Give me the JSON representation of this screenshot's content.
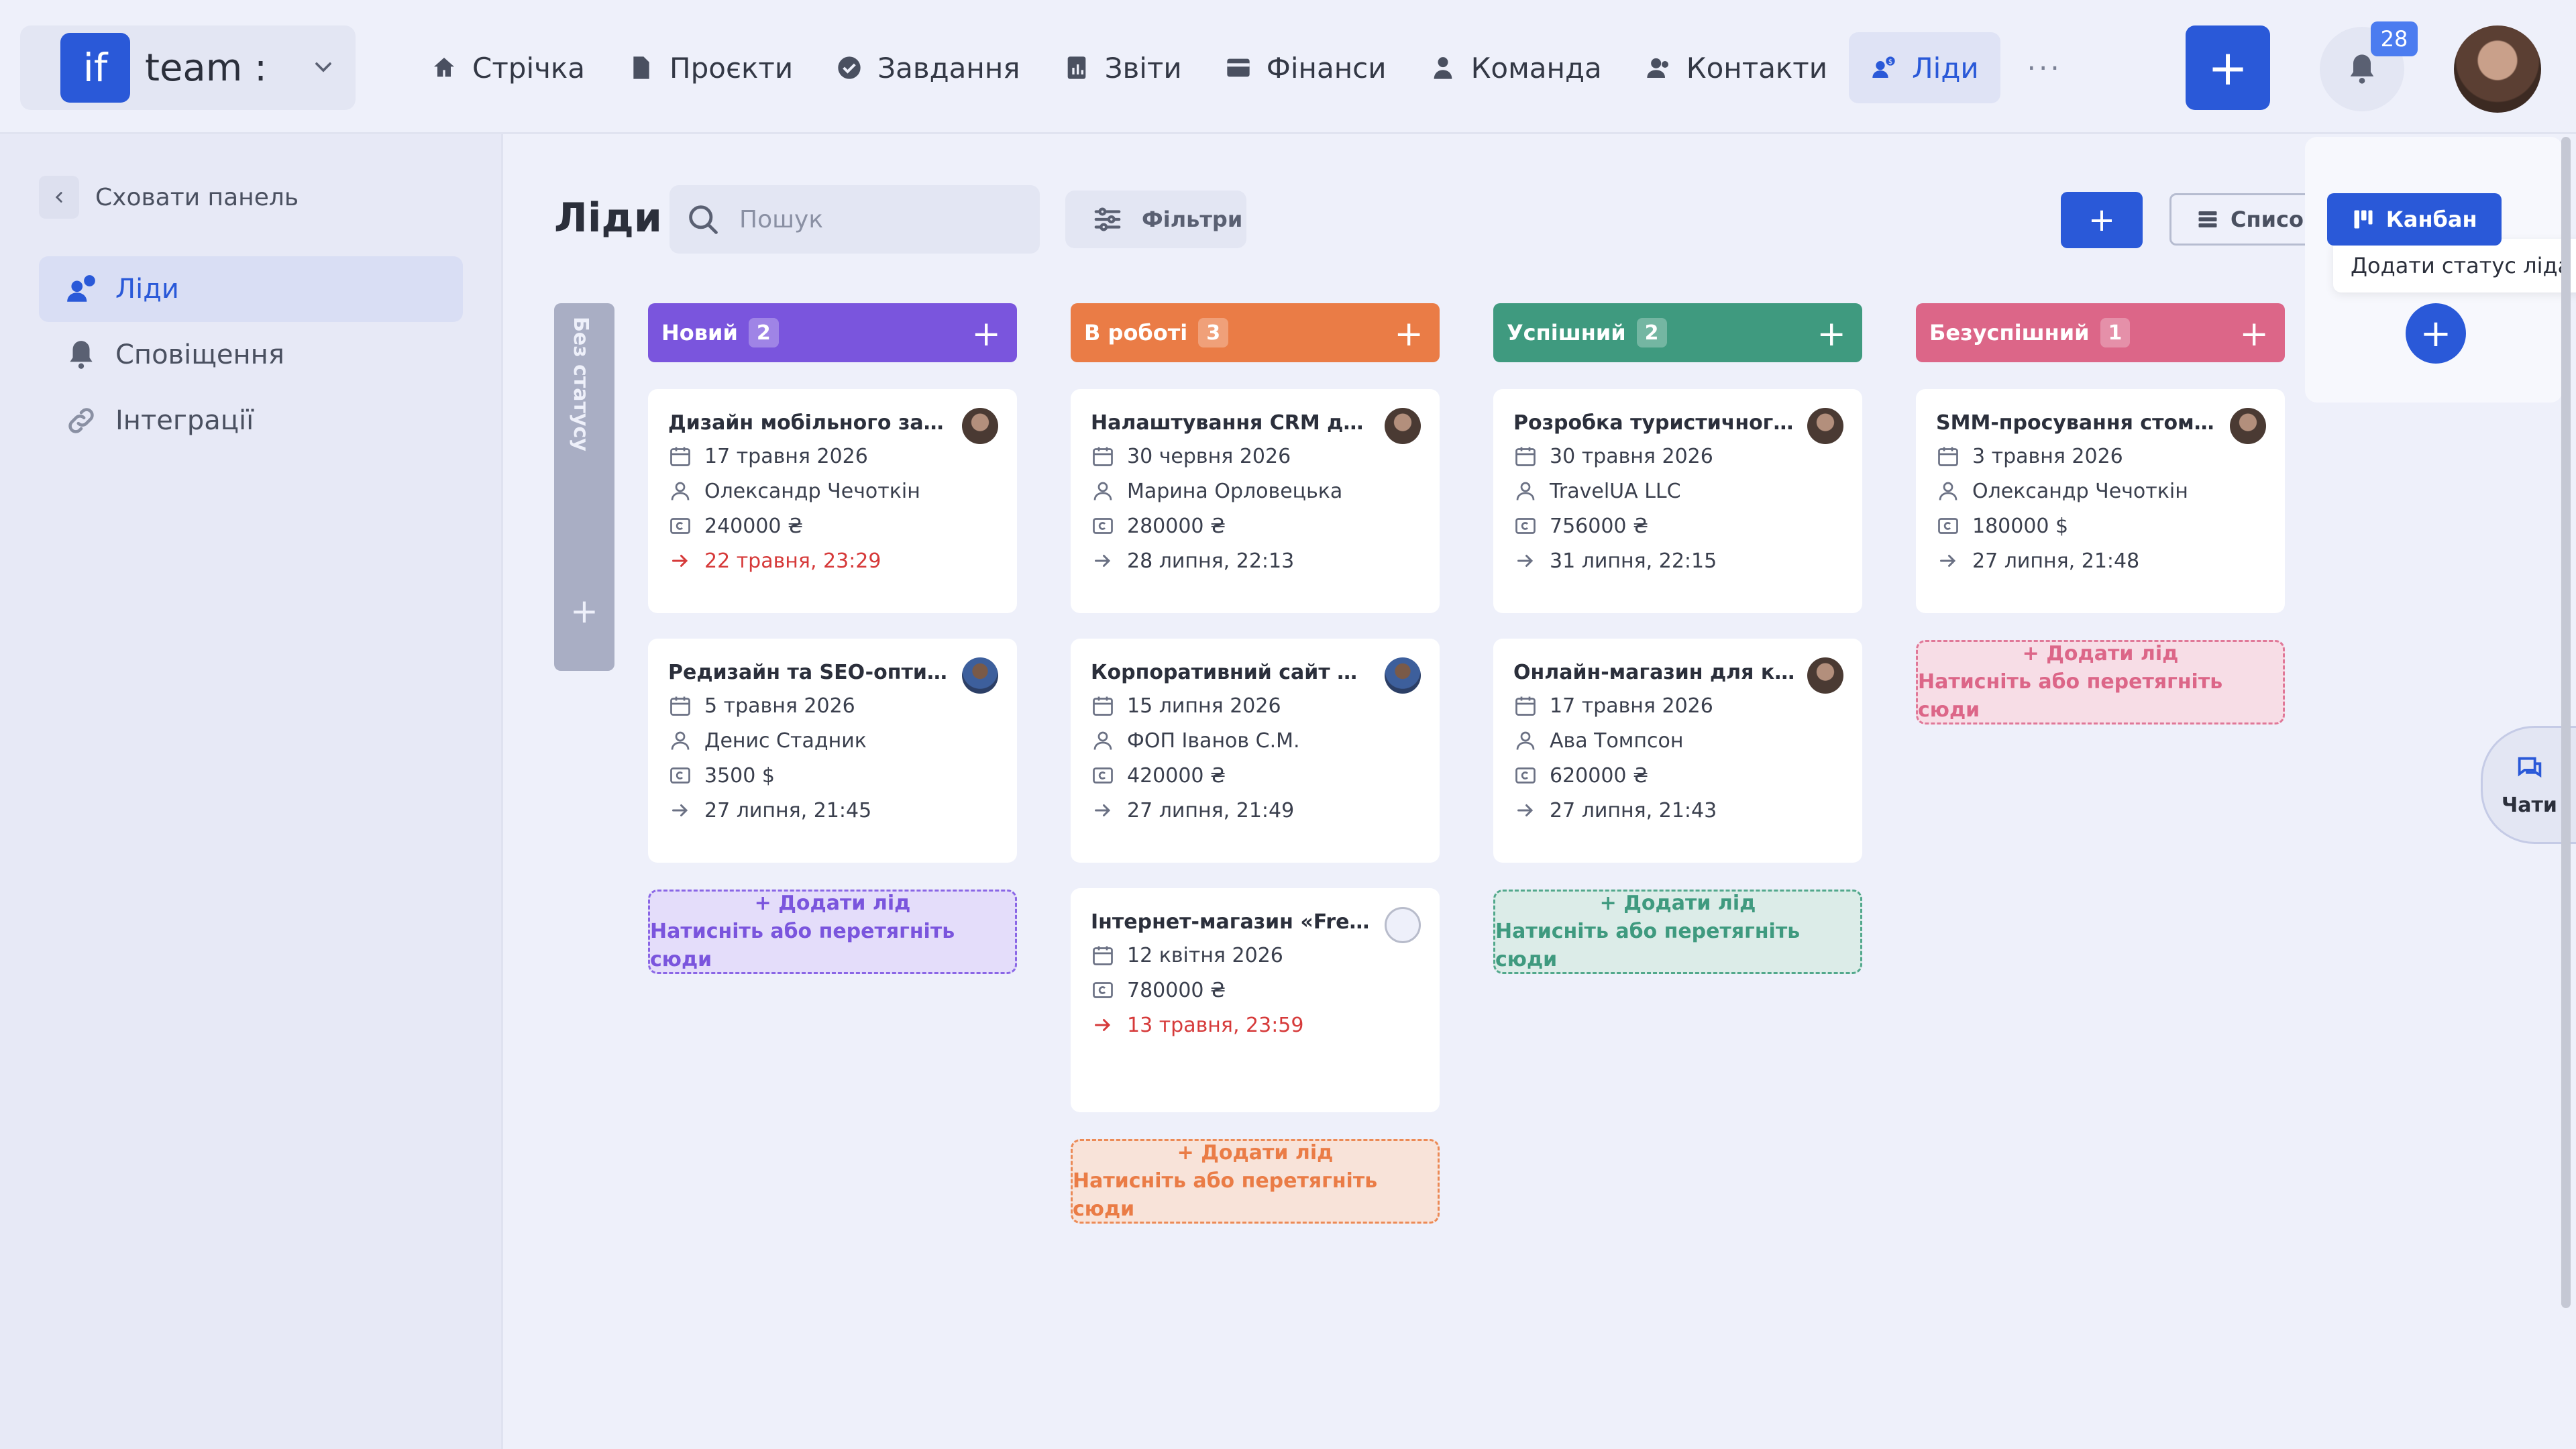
{
  "brand": {
    "logo": "if",
    "name": "team :"
  },
  "nav": [
    {
      "label": "Стрічка",
      "icon": "home-icon"
    },
    {
      "label": "Проєкти",
      "icon": "file-icon"
    },
    {
      "label": "Завдання",
      "icon": "check-circle-icon"
    },
    {
      "label": "Звіти",
      "icon": "report-icon"
    },
    {
      "label": "Фінанси",
      "icon": "wallet-icon"
    },
    {
      "label": "Команда",
      "icon": "user-icon"
    },
    {
      "label": "Контакти",
      "icon": "contacts-icon"
    },
    {
      "label": "Ліди",
      "icon": "leads-icon",
      "active": true
    }
  ],
  "nav_more": "···",
  "header": {
    "add_label": "+",
    "notifications_count": "28"
  },
  "sidebar": {
    "hide_label": "Сховати панель",
    "items": [
      {
        "label": "Ліди",
        "active": true
      },
      {
        "label": "Сповіщення"
      },
      {
        "label": "Інтеграції"
      }
    ]
  },
  "main": {
    "title": "Ліди",
    "search_placeholder": "Пошук",
    "filters_label": "Фільтри",
    "add_label": "+",
    "view_list": "Список",
    "view_kanban": "Канбан",
    "tooltip": "Додати статус ліда",
    "add_status": "+",
    "chats_label": "Чати",
    "no_status_label": "Без статусу",
    "no_status_add": "+"
  },
  "add_lead": {
    "line1": "+ Додати лід",
    "line2": "Натисніть або перетягніть сюди"
  },
  "columns": [
    {
      "name": "Новий",
      "count": "2",
      "color": "#7a55dd",
      "cards": [
        {
          "title": "Дизайн мобільного застосунку",
          "date": "17 травня 2026",
          "person": "Олександр Чечоткін",
          "amount": "240000 ₴",
          "deadline": "22 травня, 23:29",
          "overdue": true,
          "avatar": "av-a"
        },
        {
          "title": "Редизайн та SEO-оптимізація",
          "date": "5 травня 2026",
          "person": "Денис Стадник",
          "amount": "3500 $",
          "deadline": "27 липня, 21:45",
          "overdue": false,
          "avatar": "av-b"
        }
      ]
    },
    {
      "name": "В роботі",
      "count": "3",
      "color": "#ea7c46",
      "cards": [
        {
          "title": "Налаштування CRM для відділу",
          "date": "30 червня 2026",
          "person": "Марина Орловецька",
          "amount": "280000 ₴",
          "deadline": "28 липня, 22:13",
          "overdue": false,
          "avatar": "av-a"
        },
        {
          "title": "Корпоративний сайт для логістики",
          "date": "15 липня 2026",
          "person": "ФОП Іванов С.М.",
          "amount": "420000 ₴",
          "deadline": "27 липня, 21:49",
          "overdue": false,
          "avatar": "av-b"
        },
        {
          "title": "Інтернет-магазин «FreshMarket»",
          "date": "12 квітня 2026",
          "person": "",
          "amount": "780000 ₴",
          "deadline": "13 травня, 23:59",
          "overdue": true,
          "avatar": "av-c"
        }
      ]
    },
    {
      "name": "Успішний",
      "count": "2",
      "color": "#3f9a7f",
      "cards": [
        {
          "title": "Розробка туристичного веб-сайту",
          "date": "30 травня 2026",
          "person": "TravelUA LLC",
          "amount": "756000 ₴",
          "deadline": "31 липня, 22:15",
          "overdue": false,
          "avatar": "av-a"
        },
        {
          "title": "Онлайн-магазин для косметики",
          "date": "17 травня 2026",
          "person": "Ава Томпсон",
          "amount": "620000 ₴",
          "deadline": "27 липня, 21:43",
          "overdue": false,
          "avatar": "av-a"
        }
      ]
    },
    {
      "name": "Безуспішний",
      "count": "1",
      "color": "#dc6688",
      "cards": [
        {
          "title": "SMM-просування стоматології",
          "date": "3 травня 2026",
          "person": "Олександр Чечоткін",
          "amount": "180000 $",
          "deadline": "27 липня, 21:48",
          "overdue": false,
          "avatar": "av-a"
        }
      ]
    }
  ]
}
